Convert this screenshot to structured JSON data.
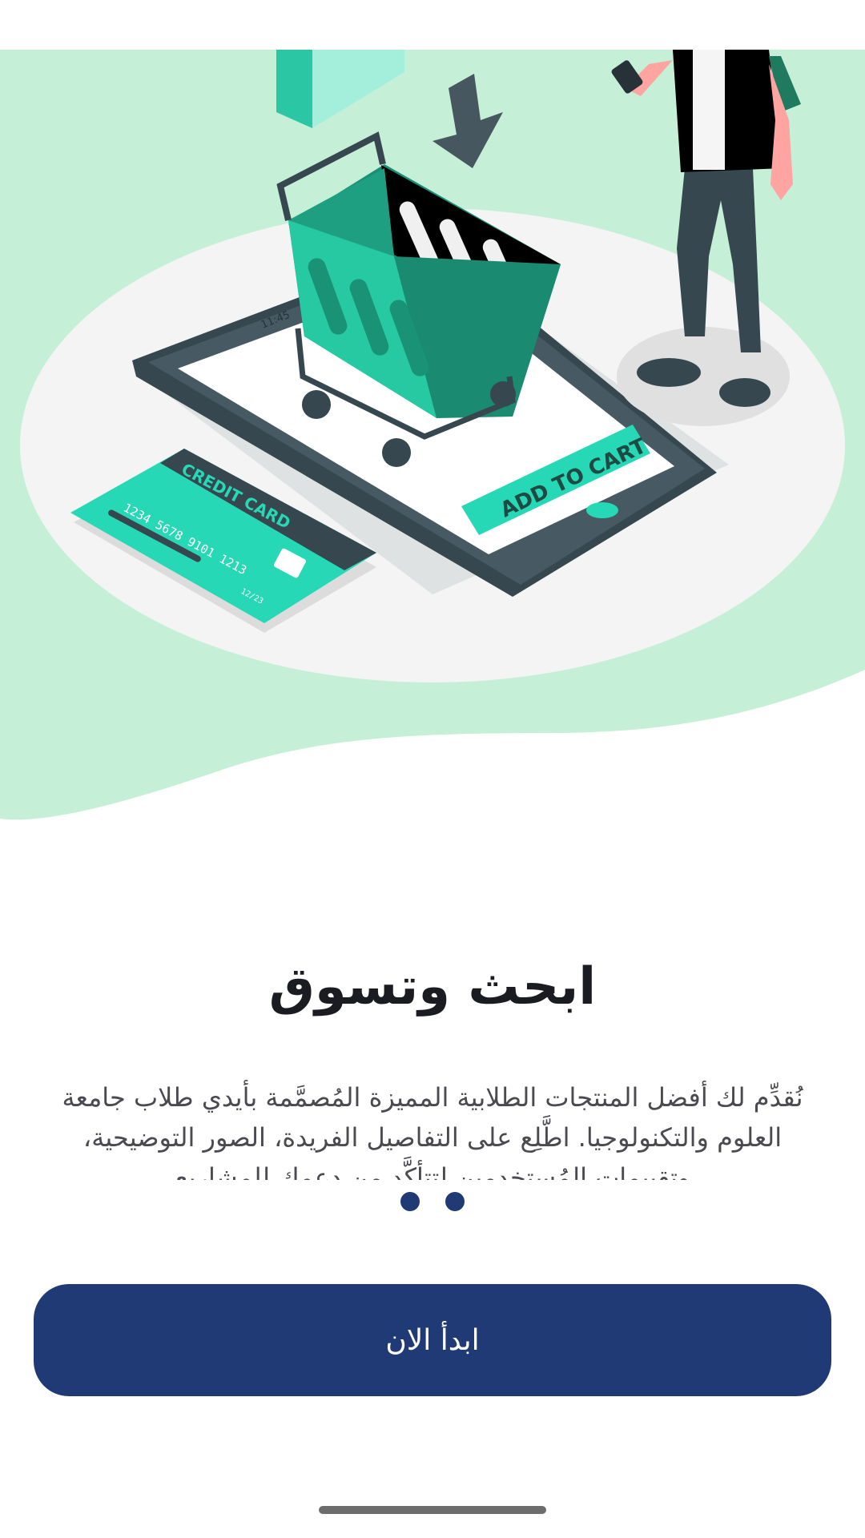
{
  "illustration": {
    "card_title": "CREDIT CARD",
    "card_number": "1234 5678 9101 1213",
    "card_expiry": "12/23",
    "phone_time": "11:45",
    "phone_button_label": "ADD TO CART"
  },
  "onboarding": {
    "title": "ابحث وتسوق",
    "description": "نُقدِّم لك أفضل المنتجات الطلابية المميزة المُصمَّمة بأيدي طلاب جامعة العلوم والتكنولوجيا. اطَّلِع على التفاصيل الفريدة، الصور التوضيحية، وتقييمات المُستخدمين لتتأكَّد من دعمك للمشاريع",
    "page_count": 2,
    "start_button": "ابدأ الان"
  },
  "colors": {
    "primary": "#1f3a75",
    "hero_background": "#c6efd8",
    "accent_teal": "#26d8b6"
  }
}
